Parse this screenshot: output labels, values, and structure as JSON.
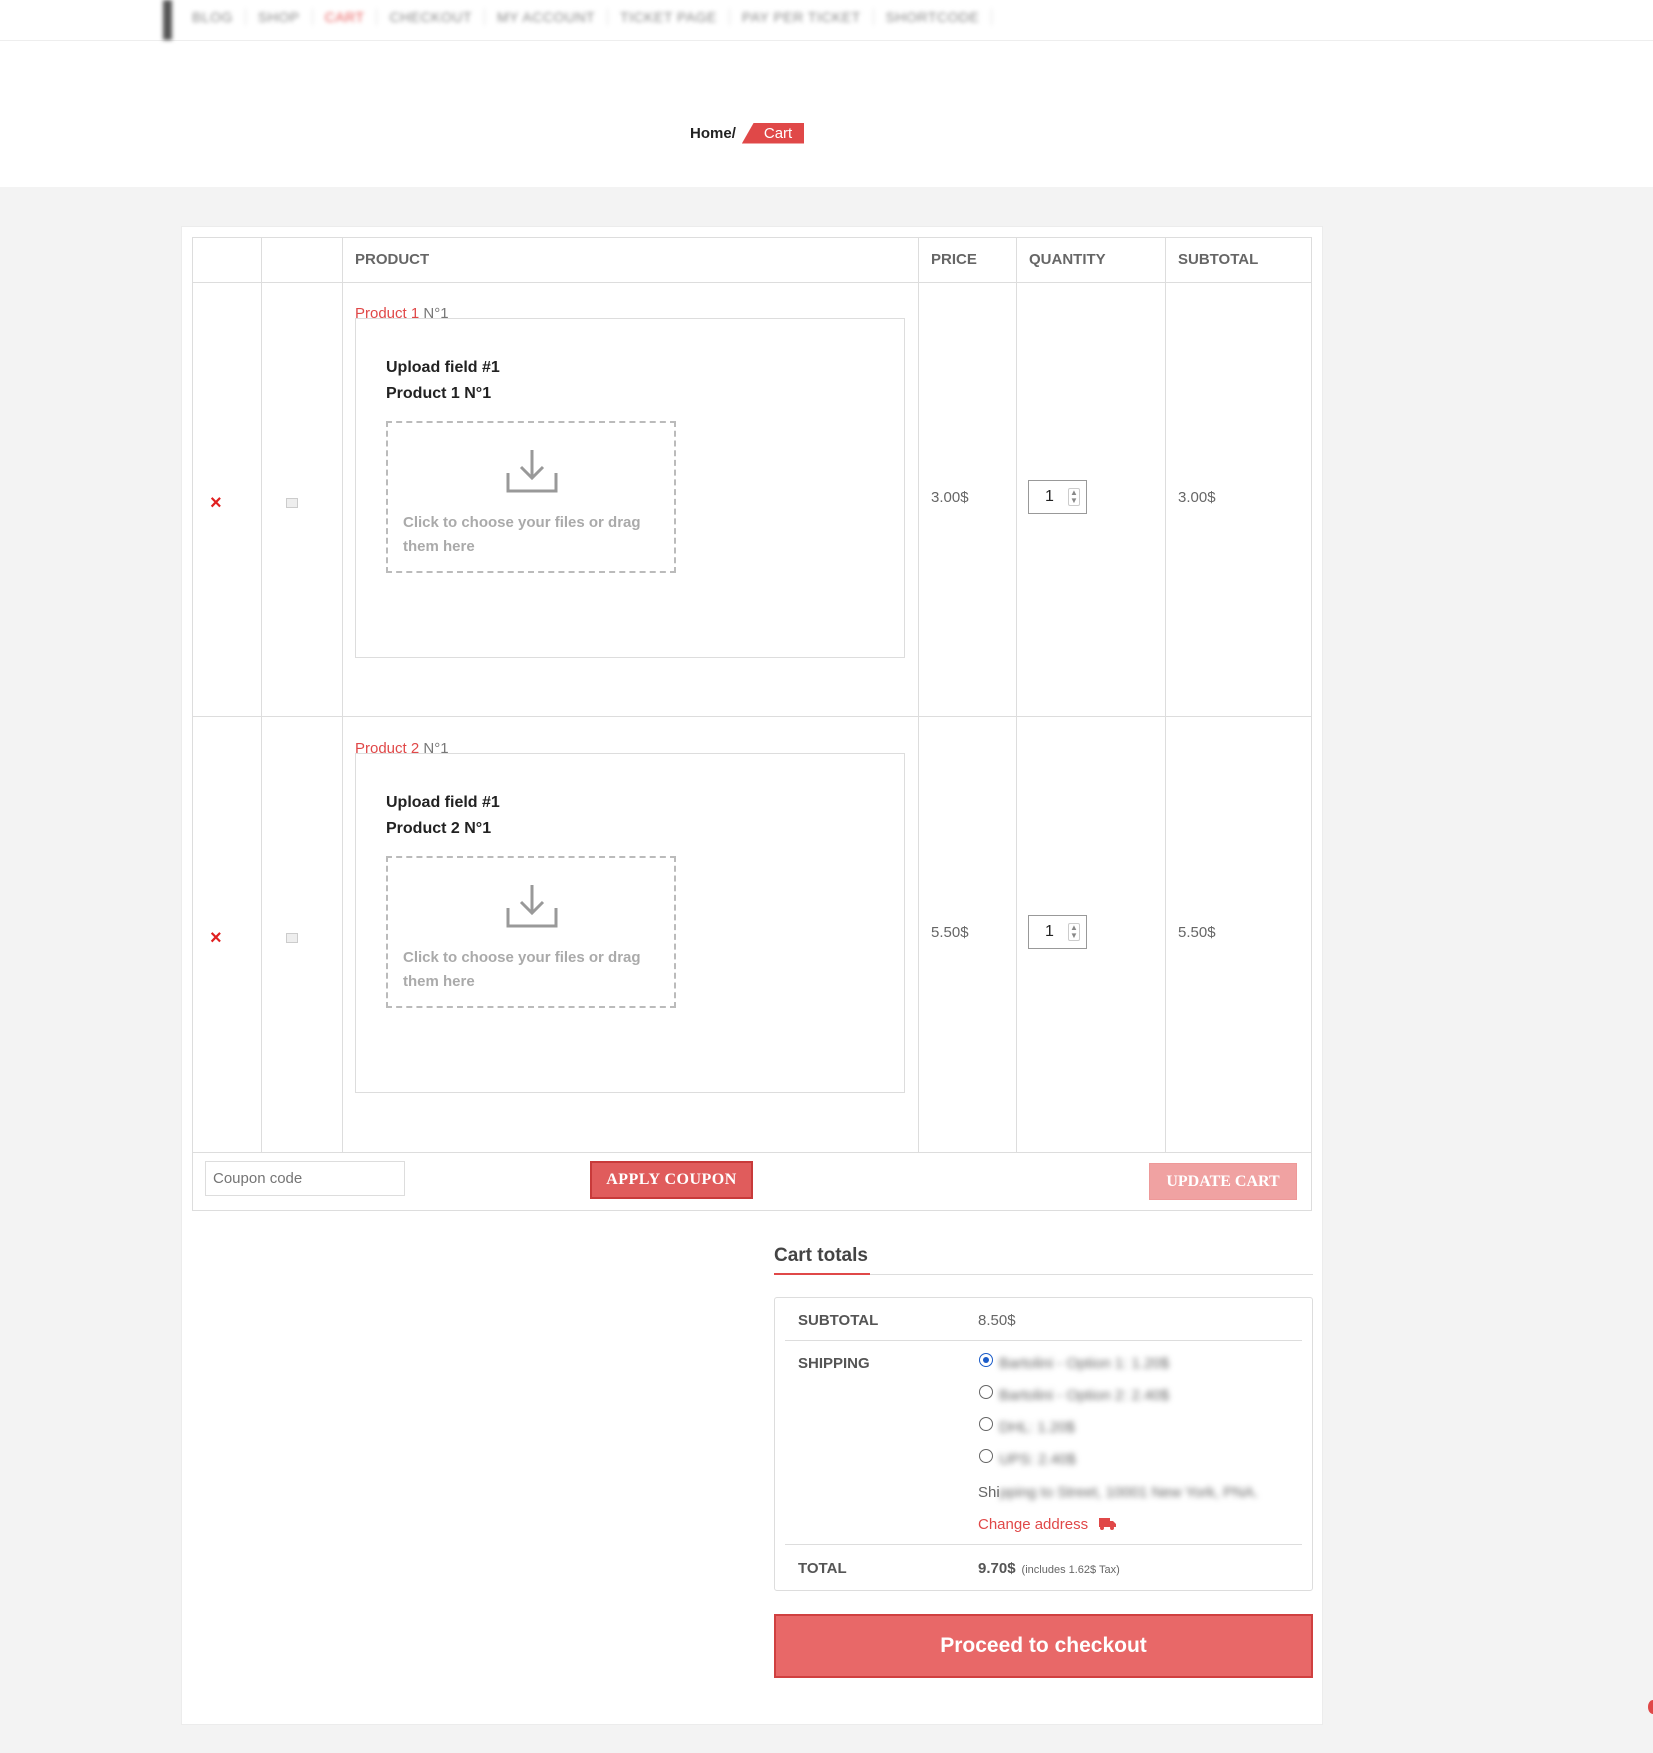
{
  "nav": {
    "items": [
      "BLOG",
      "SHOP",
      "CART",
      "CHECKOUT",
      "MY ACCOUNT",
      "TICKET PAGE",
      "PAY PER TICKET",
      "SHORTCODE"
    ],
    "active_index": 2
  },
  "breadcrumb": {
    "home": "Home",
    "separator": "/",
    "current": "Cart"
  },
  "table": {
    "headers": {
      "product": "PRODUCT",
      "price": "PRICE",
      "quantity": "QUANTITY",
      "subtotal": "SUBTOTAL"
    },
    "rows": [
      {
        "remove": "×",
        "product_link": "Product 1",
        "product_sku": "N°1",
        "upload_label": "Upload field #1",
        "upload_product": "Product 1 N°1",
        "dropzone_text": "Click to choose your files or drag them here",
        "price": "3.00$",
        "quantity": "1",
        "subtotal": "3.00$"
      },
      {
        "remove": "×",
        "product_link": "Product 2",
        "product_sku": "N°1",
        "upload_label": "Upload field #1",
        "upload_product": "Product 2 N°1",
        "dropzone_text": "Click to choose your files or drag them here",
        "price": "5.50$",
        "quantity": "1",
        "subtotal": "5.50$"
      }
    ],
    "coupon_placeholder": "Coupon code",
    "apply_coupon": "APPLY COUPON",
    "update_cart": "UPDATE CART"
  },
  "totals": {
    "title": "Cart totals",
    "subtotal_label": "SUBTOTAL",
    "subtotal_value": "8.50$",
    "shipping_label": "SHIPPING",
    "shipping_options": [
      "Bartolini - Option 1: 1.20$",
      "Bartolini - Option 2: 2.40$",
      "DHL: 1.20$",
      "UPS: 2.40$"
    ],
    "shipping_selected": 0,
    "shipping_to_prefix": "Shi",
    "shipping_to_rest": "pping to Street, 10001 New York, PNA.",
    "change_address": "Change address",
    "total_label": "TOTAL",
    "total_value": "9.70$",
    "total_tax_note": "(includes 1.62$  Tax)"
  },
  "checkout_button": "Proceed to checkout",
  "colors": {
    "accent": "#e04848",
    "button": "#e86868",
    "radio": "#1a5bc8"
  }
}
